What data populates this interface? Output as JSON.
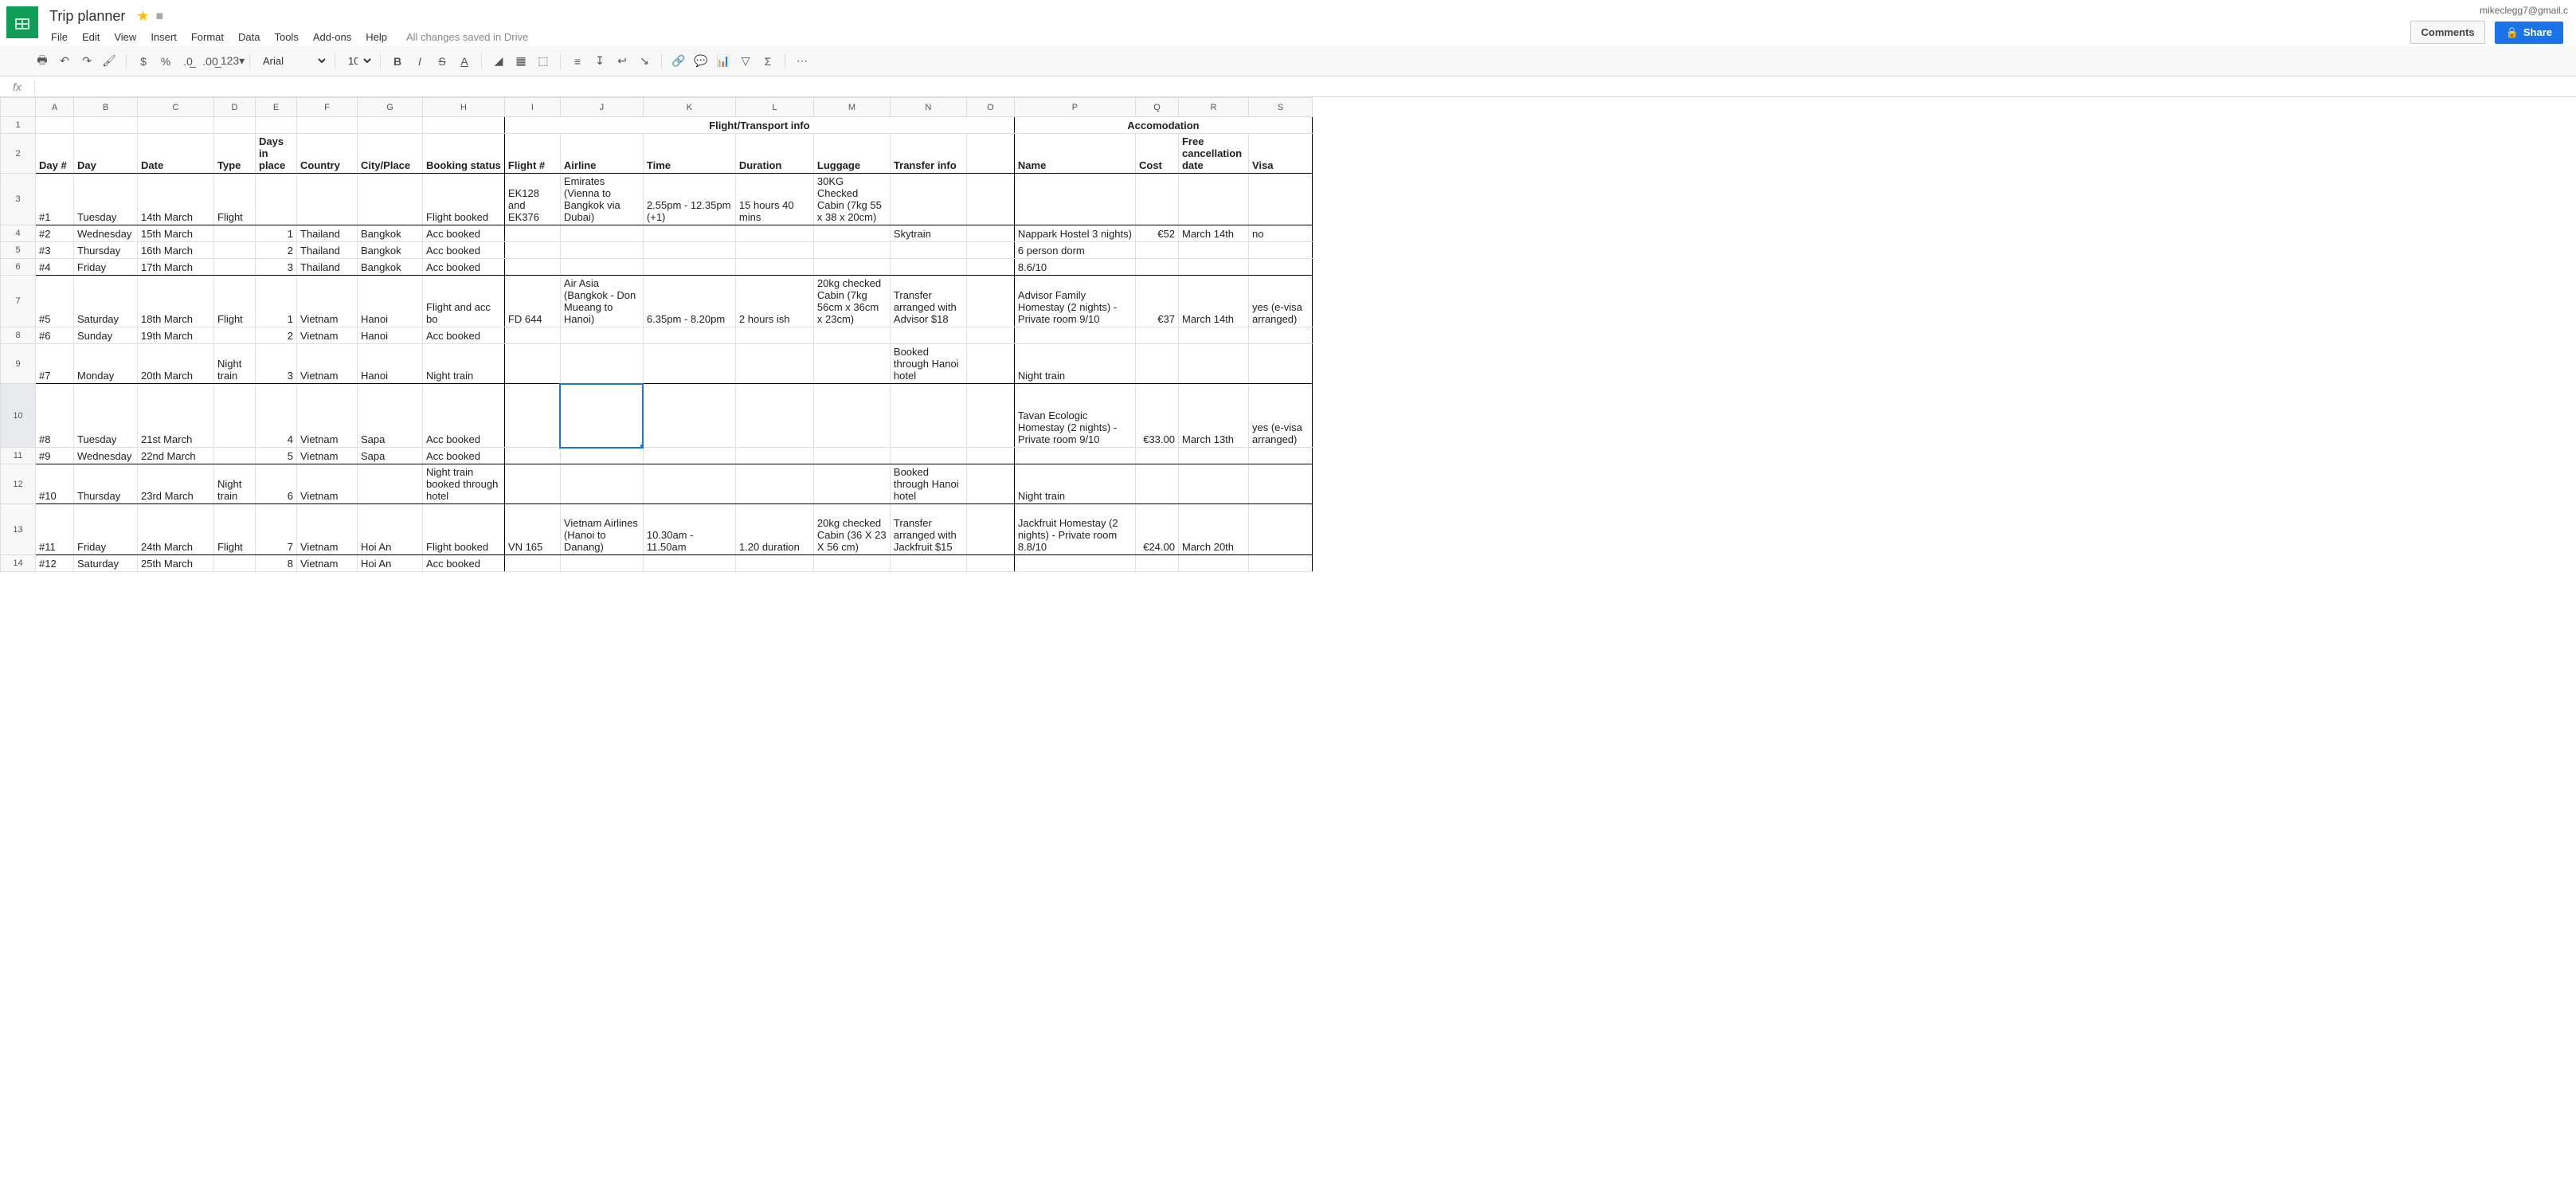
{
  "doc": {
    "title": "Trip planner",
    "save_status": "All changes saved in Drive",
    "user_email": "mikeclegg7@gmail.c"
  },
  "menu": {
    "file": "File",
    "edit": "Edit",
    "view": "View",
    "insert": "Insert",
    "format": "Format",
    "data": "Data",
    "tools": "Tools",
    "addons": "Add-ons",
    "help": "Help"
  },
  "buttons": {
    "comments": "Comments",
    "share": "Share"
  },
  "toolbar": {
    "font": "Arial",
    "size": "10"
  },
  "columns": [
    "A",
    "B",
    "C",
    "D",
    "E",
    "F",
    "G",
    "H",
    "I",
    "J",
    "K",
    "L",
    "M",
    "N",
    "O",
    "P",
    "Q",
    "R",
    "S"
  ],
  "section_headers": {
    "flight": "Flight/Transport info",
    "accom": "Accomodation"
  },
  "headers": {
    "day_num": "Day #",
    "day": "Day",
    "date": "Date",
    "type": "Type",
    "days_in_place": "Days in place",
    "country": "Country",
    "city": "City/Place",
    "booking": "Booking status",
    "flight_num": "Flight #",
    "airline": "Airline",
    "time": "Time",
    "duration": "Duration",
    "luggage": "Luggage",
    "transfer": "Transfer info",
    "name": "Name",
    "cost": "Cost",
    "cancel": "Free cancellation date",
    "visa": "Visa"
  },
  "rows": [
    {
      "n": "3",
      "a": "#1",
      "b": "Tuesday",
      "c": "14th March",
      "d": "Flight",
      "e": "",
      "f": "",
      "g": "",
      "h": "Flight booked",
      "i": "EK128 and EK376",
      "j": "Emirates (Vienna to Bangkok via Dubai)",
      "k": "2.55pm - 12.35pm (+1)",
      "l": "15 hours 40 mins",
      "m": "30KG Checked Cabin (7kg 55 x 38 x 20cm)",
      "n2": "",
      "o": "",
      "p": "",
      "q": "",
      "r": "",
      "s": ""
    },
    {
      "n": "4",
      "a": "#2",
      "b": "Wednesday",
      "c": "15th March",
      "d": "",
      "e": "1",
      "f": "Thailand",
      "g": "Bangkok",
      "h": "Acc booked",
      "i": "",
      "j": "",
      "k": "",
      "l": "",
      "m": "",
      "n2": "Skytrain",
      "o": "",
      "p": "Nappark Hostel 3 nights)",
      "q": "€52",
      "r": "March 14th",
      "s": "no"
    },
    {
      "n": "5",
      "a": "#3",
      "b": "Thursday",
      "c": "16th March",
      "d": "",
      "e": "2",
      "f": "Thailand",
      "g": "Bangkok",
      "h": "Acc booked",
      "i": "",
      "j": "",
      "k": "",
      "l": "",
      "m": "",
      "n2": "",
      "o": "",
      "p": "6 person dorm",
      "q": "",
      "r": "",
      "s": ""
    },
    {
      "n": "6",
      "a": "#4",
      "b": "Friday",
      "c": "17th March",
      "d": "",
      "e": "3",
      "f": "Thailand",
      "g": "Bangkok",
      "h": "Acc booked",
      "i": "",
      "j": "",
      "k": "",
      "l": "",
      "m": "",
      "n2": "",
      "o": "",
      "p": "8.6/10",
      "q": "",
      "r": "",
      "s": ""
    },
    {
      "n": "7",
      "a": "#5",
      "b": "Saturday",
      "c": "18th March",
      "d": "Flight",
      "e": "1",
      "f": "Vietnam",
      "g": "Hanoi",
      "h": "Flight and acc bo",
      "i": "FD 644",
      "j": "Air Asia (Bangkok - Don Mueang to Hanoi)",
      "k": "6.35pm - 8.20pm",
      "l": "2 hours ish",
      "m": "20kg checked Cabin (7kg 56cm x 36cm x 23cm)",
      "n2": "Transfer arranged with Advisor $18",
      "o": "",
      "p": "Advisor Family Homestay (2 nights) - Private room 9/10",
      "q": "€37",
      "r": "March 14th",
      "s": "yes (e-visa arranged)"
    },
    {
      "n": "8",
      "a": "#6",
      "b": "Sunday",
      "c": "19th March",
      "d": "",
      "e": "2",
      "f": "Vietnam",
      "g": "Hanoi",
      "h": "Acc booked",
      "i": "",
      "j": "",
      "k": "",
      "l": "",
      "m": "",
      "n2": "",
      "o": "",
      "p": "",
      "q": "",
      "r": "",
      "s": ""
    },
    {
      "n": "9",
      "a": "#7",
      "b": "Monday",
      "c": "20th March",
      "d": "Night train",
      "e": "3",
      "f": "Vietnam",
      "g": "Hanoi",
      "h": "Night train",
      "i": "",
      "j": "",
      "k": "",
      "l": "",
      "m": "",
      "n2": "Booked through Hanoi hotel",
      "o": "",
      "p": "Night train",
      "q": "",
      "r": "",
      "s": ""
    },
    {
      "n": "10",
      "a": "#8",
      "b": "Tuesday",
      "c": "21st March",
      "d": "",
      "e": "4",
      "f": "Vietnam",
      "g": "Sapa",
      "h": "Acc booked",
      "i": "",
      "j": "",
      "k": "",
      "l": "",
      "m": "",
      "n2": "",
      "o": "",
      "p": "Tavan Ecologic Homestay (2 nights) - Private room 9/10",
      "q": "€33.00",
      "r": "March 13th",
      "s": "yes (e-visa arranged)"
    },
    {
      "n": "11",
      "a": "#9",
      "b": "Wednesday",
      "c": "22nd March",
      "d": "",
      "e": "5",
      "f": "Vietnam",
      "g": "Sapa",
      "h": "Acc booked",
      "i": "",
      "j": "",
      "k": "",
      "l": "",
      "m": "",
      "n2": "",
      "o": "",
      "p": "",
      "q": "",
      "r": "",
      "s": ""
    },
    {
      "n": "12",
      "a": "#10",
      "b": "Thursday",
      "c": "23rd March",
      "d": "Night train",
      "e": "6",
      "f": "Vietnam",
      "g": "",
      "h": "Night train booked through hotel",
      "i": "",
      "j": "",
      "k": "",
      "l": "",
      "m": "",
      "n2": "Booked through Hanoi hotel",
      "o": "",
      "p": "Night train",
      "q": "",
      "r": "",
      "s": ""
    },
    {
      "n": "13",
      "a": "#11",
      "b": "Friday",
      "c": "24th March",
      "d": "Flight",
      "e": "7",
      "f": "Vietnam",
      "g": "Hoi An",
      "h": "Flight booked",
      "i": "VN 165",
      "j": "Vietnam Airlines (Hanoi to Danang)",
      "k": "10.30am - 11.50am",
      "l": "1.20 duration",
      "m": "20kg checked Cabin (36 X 23 X 56 cm)",
      "n2": "Transfer arranged with Jackfruit $15",
      "o": "",
      "p": "Jackfruit Homestay (2 nights) - Private room 8.8/10",
      "q": "€24.00",
      "r": "March 20th",
      "s": ""
    },
    {
      "n": "14",
      "a": "#12",
      "b": "Saturday",
      "c": "25th March",
      "d": "",
      "e": "8",
      "f": "Vietnam",
      "g": "Hoi An",
      "h": "Acc booked",
      "i": "",
      "j": "",
      "k": "",
      "l": "",
      "m": "",
      "n2": "",
      "o": "",
      "p": "",
      "q": "",
      "r": "",
      "s": ""
    }
  ],
  "row_meta": {
    "tall": {
      "3": 56,
      "7": 64,
      "9": 34,
      "10": 80,
      "12": 50,
      "13": 64
    },
    "thick_bottom": [
      "2",
      "3",
      "6",
      "9",
      "11",
      "12",
      "13"
    ]
  }
}
